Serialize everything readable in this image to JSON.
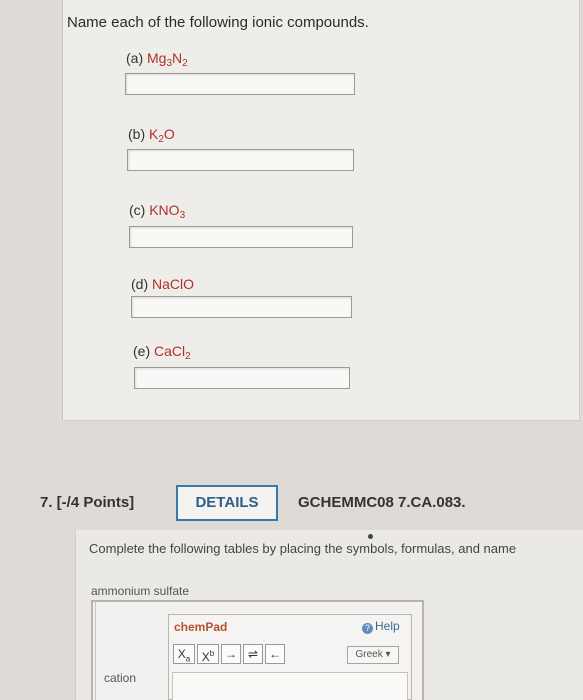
{
  "question6": {
    "instruction": "Name each of the following ionic compounds.",
    "items": [
      {
        "letter": "(a)",
        "formula_parts": [
          "Mg",
          "3",
          "N",
          "2"
        ]
      },
      {
        "letter": "(b)",
        "formula_parts": [
          "K",
          "2",
          "O"
        ]
      },
      {
        "letter": "(c)",
        "formula_parts": [
          "KNO",
          "3"
        ]
      },
      {
        "letter": "(d)",
        "formula_parts": [
          "NaClO"
        ]
      },
      {
        "letter": "(e)",
        "formula_parts": [
          "CaCl",
          "2"
        ]
      }
    ]
  },
  "question7": {
    "heading": "7. [-/4 Points]",
    "details_label": "DETAILS",
    "code": "GCHEMMC08 7.CA.083.",
    "instruction": "Complete the following tables by placing the symbols, formulas, and name",
    "compound_label": "ammonium sulfate",
    "row_label": "cation",
    "chempad": {
      "title": "chemPad",
      "help_label": "Help",
      "greek_label": "Greek ▾",
      "tools": {
        "subscript_base": "X",
        "subscript": "a",
        "superscript_base": "X",
        "superscript": "b",
        "arrow": "→",
        "equilibrium": "⇌",
        "back_arrow": "←"
      }
    }
  }
}
